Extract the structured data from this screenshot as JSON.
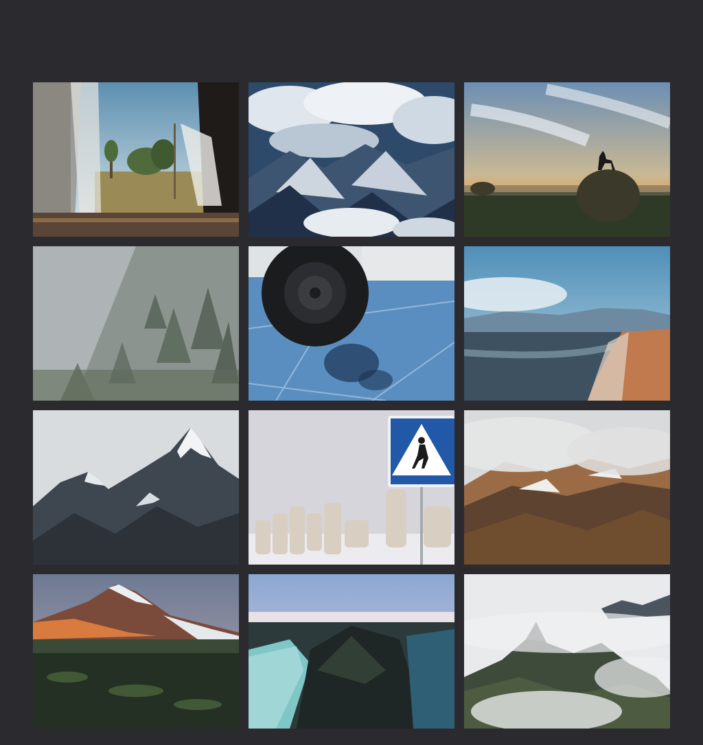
{
  "gallery": {
    "photos": [
      {
        "id": "train-window-view"
      },
      {
        "id": "clouds-over-mountains"
      },
      {
        "id": "dog-on-haystack-sunset"
      },
      {
        "id": "foggy-forest-slope"
      },
      {
        "id": "car-wheel-on-ice"
      },
      {
        "id": "lake-shore-mountains"
      },
      {
        "id": "snowy-mountain-peaks"
      },
      {
        "id": "pedestrian-sign-breakwater"
      },
      {
        "id": "rocky-hills-in-fog"
      },
      {
        "id": "volcano-at-dusk"
      },
      {
        "id": "cliff-above-frozen-sea"
      },
      {
        "id": "peak-above-clouds"
      }
    ]
  },
  "colors": {
    "background": "#2b2b2f"
  }
}
